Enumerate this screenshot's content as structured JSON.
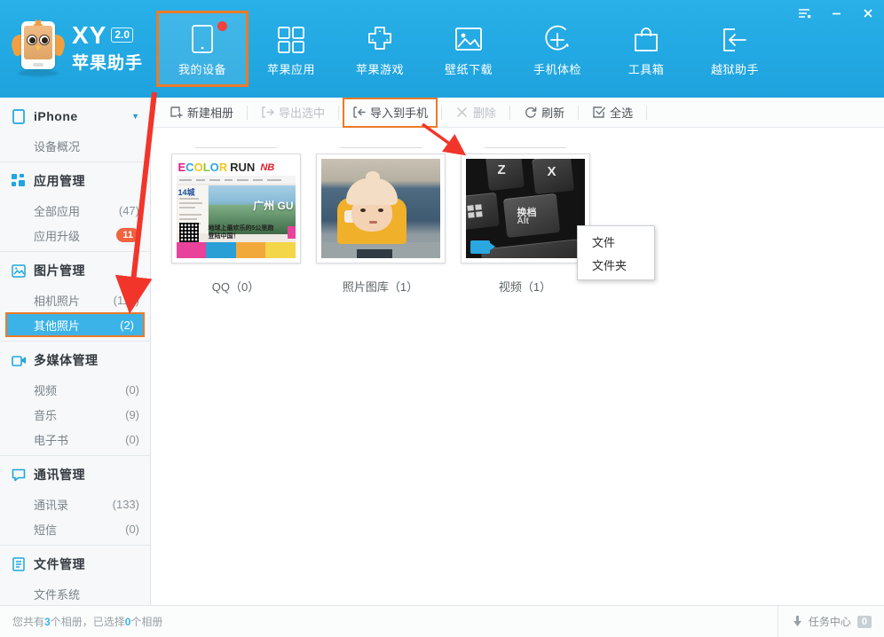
{
  "window": {
    "controls": [
      {
        "name": "menu-icon",
        "label": "≡"
      },
      {
        "name": "minimize-icon",
        "label": "−"
      },
      {
        "name": "close-icon",
        "label": "✕"
      }
    ]
  },
  "brand": {
    "name": "XY",
    "version": "2.0",
    "subtitle": "苹果助手"
  },
  "nav": {
    "items": [
      {
        "id": "my-device",
        "label": "我的设备",
        "icon": "tablet-icon",
        "active": true,
        "badge_dot": true,
        "highlight": true
      },
      {
        "id": "apple-apps",
        "label": "苹果应用",
        "icon": "grid-icon",
        "active": false,
        "badge_dot": false,
        "highlight": false
      },
      {
        "id": "apple-games",
        "label": "苹果游戏",
        "icon": "gamepad-icon",
        "active": false,
        "badge_dot": false,
        "highlight": false
      },
      {
        "id": "wallpaper",
        "label": "壁纸下载",
        "icon": "picture-icon",
        "active": false,
        "badge_dot": false,
        "highlight": false
      },
      {
        "id": "phone-check",
        "label": "手机体检",
        "icon": "plus-circle-icon",
        "active": false,
        "badge_dot": false,
        "highlight": false
      },
      {
        "id": "toolbox",
        "label": "工具箱",
        "icon": "bag-icon",
        "active": false,
        "badge_dot": false,
        "highlight": false
      },
      {
        "id": "jailbreak",
        "label": "越狱助手",
        "icon": "arrow-left-box-icon",
        "active": false,
        "badge_dot": false,
        "highlight": false
      }
    ]
  },
  "sidebar": {
    "groups": [
      {
        "id": "device",
        "title": "iPhone",
        "icon": "phone-icon",
        "caret": true,
        "children": [
          {
            "id": "device-overview",
            "label": "设备概况",
            "count": "",
            "badge": "",
            "selected": false
          }
        ]
      },
      {
        "id": "app-manage",
        "title": "应用管理",
        "icon": "apps-icon",
        "caret": false,
        "children": [
          {
            "id": "all-apps",
            "label": "全部应用",
            "count": "(47)",
            "badge": "",
            "selected": false
          },
          {
            "id": "app-upgrade",
            "label": "应用升级",
            "count": "",
            "badge": "11",
            "selected": false
          }
        ]
      },
      {
        "id": "photo-manage",
        "title": "图片管理",
        "icon": "image-icon",
        "caret": false,
        "children": [
          {
            "id": "camera-photos",
            "label": "相机照片",
            "count": "(116)",
            "badge": "",
            "selected": false
          },
          {
            "id": "other-photos",
            "label": "其他照片",
            "count": "(2)",
            "badge": "",
            "selected": true
          }
        ]
      },
      {
        "id": "media-manage",
        "title": "多媒体管理",
        "icon": "video-icon",
        "caret": false,
        "children": [
          {
            "id": "videos",
            "label": "视频",
            "count": "(0)",
            "badge": "",
            "selected": false
          },
          {
            "id": "music",
            "label": "音乐",
            "count": "(9)",
            "badge": "",
            "selected": false
          },
          {
            "id": "ebooks",
            "label": "电子书",
            "count": "(0)",
            "badge": "",
            "selected": false
          }
        ]
      },
      {
        "id": "contact-manage",
        "title": "通讯管理",
        "icon": "chat-icon",
        "caret": false,
        "children": [
          {
            "id": "contacts",
            "label": "通讯录",
            "count": "(133)",
            "badge": "",
            "selected": false
          },
          {
            "id": "sms",
            "label": "短信",
            "count": "(0)",
            "badge": "",
            "selected": false
          }
        ]
      },
      {
        "id": "file-manage",
        "title": "文件管理",
        "icon": "document-icon",
        "caret": false,
        "children": [
          {
            "id": "file-system",
            "label": "文件系统",
            "count": "",
            "badge": "",
            "selected": false
          }
        ]
      }
    ]
  },
  "toolbar": {
    "buttons": [
      {
        "id": "new-album",
        "label": "新建相册",
        "icon": "new-album-icon",
        "disabled": false,
        "highlight": false
      },
      {
        "id": "export-select",
        "label": "导出选中",
        "icon": "export-icon",
        "disabled": true,
        "highlight": false
      },
      {
        "id": "import-phone",
        "label": "导入到手机",
        "icon": "import-icon",
        "disabled": false,
        "highlight": true
      },
      {
        "id": "delete",
        "label": "删除",
        "icon": "close-x-icon",
        "disabled": true,
        "highlight": false
      },
      {
        "id": "refresh",
        "label": "刷新",
        "icon": "refresh-icon",
        "disabled": false,
        "highlight": false
      },
      {
        "id": "select-all",
        "label": "全选",
        "icon": "checkbox-icon",
        "disabled": false,
        "highlight": false
      }
    ]
  },
  "dropdown": {
    "open": true,
    "items": [
      {
        "id": "dd-file",
        "label": "文件"
      },
      {
        "id": "dd-folder",
        "label": "文件夹"
      }
    ]
  },
  "content": {
    "albums": [
      {
        "id": "album-qq",
        "name": "QQ（0）",
        "thumb": "poster-thumbnail",
        "video_badge": false
      },
      {
        "id": "album-library",
        "name": "照片图库（1）",
        "thumb": "baby-thumbnail",
        "video_badge": false
      },
      {
        "id": "album-video",
        "name": "视频（1）",
        "thumb": "keyboard-thumbnail",
        "video_badge": true
      }
    ],
    "poster_text": {
      "e": "E",
      "color": "COLOR",
      "run": "RUN",
      "brand": "NB",
      "city": "广州 GU",
      "badge": "14城",
      "caption": "地球上最欢乐的5公里跑\n登陆中国！"
    },
    "keyboard_text": {
      "z": "Z",
      "x": "X",
      "alt_cn": "换档",
      "alt_en": "Alt"
    }
  },
  "statusbar": {
    "text_before": "您共有",
    "album_total": "3",
    "text_middle": "个相册，已选择",
    "selected_count": "0",
    "text_after": "个相册",
    "task_label": "任务中心",
    "task_count": "0",
    "task_icon": "download-arrow-icon"
  },
  "annotations": {
    "arrow_color": "#f2352a",
    "highlight_color": "#ec7a28"
  }
}
